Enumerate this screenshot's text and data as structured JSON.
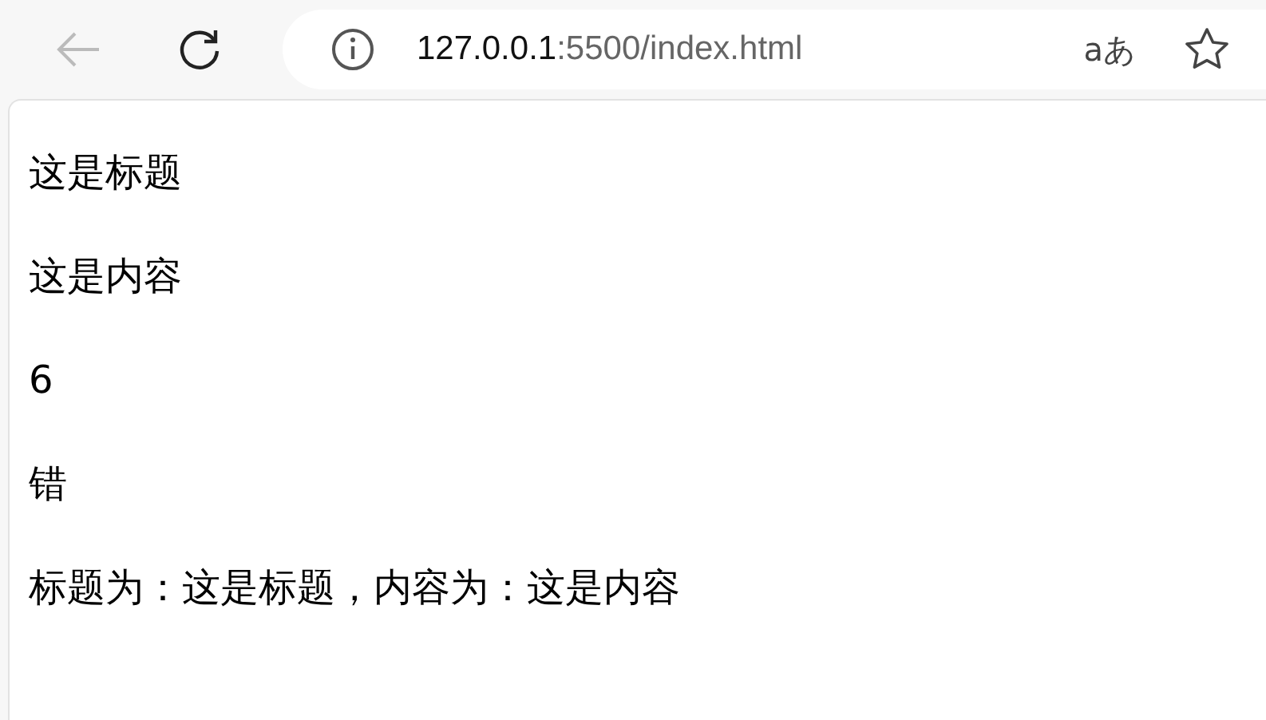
{
  "toolbar": {
    "back": {
      "disabled": true
    },
    "address": {
      "host": "127.0.0.1",
      "path": ":5500/index.html"
    },
    "read_aloud": "aあ"
  },
  "page": {
    "paragraphs": [
      "这是标题",
      "这是内容",
      "6",
      "错",
      "标题为：这是标题，内容为：这是内容"
    ]
  }
}
